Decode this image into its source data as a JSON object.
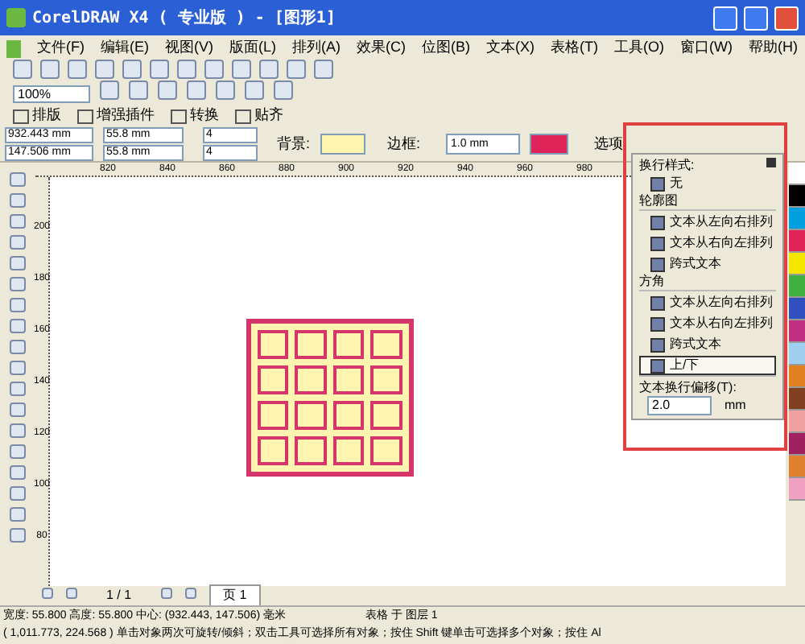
{
  "window": {
    "title": "CorelDRAW X4 ( 专业版 ) - [图形1]"
  },
  "menu": [
    "文件(F)",
    "编辑(E)",
    "视图(V)",
    "版面(L)",
    "排列(A)",
    "效果(C)",
    "位图(B)",
    "文本(X)",
    "表格(T)",
    "工具(O)",
    "窗口(W)",
    "帮助(H)"
  ],
  "zoom": {
    "value": "100%"
  },
  "plugin_toolbar": [
    "排版",
    "增强插件",
    "转换",
    "贴齐"
  ],
  "property_bar": {
    "x": "932.443 mm",
    "y": "147.506 mm",
    "width": "55.8 mm",
    "height": "55.8 mm",
    "columns": "4",
    "rows": "4",
    "background_label": "背景:",
    "border_label": "边框:",
    "border_width": "1.0 mm",
    "options": "选项"
  },
  "ruler": {
    "x_ticks": [
      "820",
      "840",
      "860",
      "880",
      "900",
      "920",
      "940",
      "960",
      "980"
    ],
    "y_ticks": [
      "200",
      "180",
      "160",
      "140",
      "120",
      "100",
      "80"
    ]
  },
  "wrap_panel": {
    "title": "换行样式:",
    "sections": [
      {
        "items": [
          {
            "label": "无",
            "selected": false
          }
        ]
      },
      {
        "heading": "轮廓图",
        "items": [
          {
            "label": "文本从左向右排列",
            "selected": false
          },
          {
            "label": "文本从右向左排列",
            "selected": false
          },
          {
            "label": "跨式文本",
            "selected": false
          }
        ]
      },
      {
        "heading": "方角",
        "items": [
          {
            "label": "文本从左向右排列",
            "selected": false
          },
          {
            "label": "文本从右向左排列",
            "selected": false
          },
          {
            "label": "跨式文本",
            "selected": false
          },
          {
            "label": "上/下",
            "selected": true
          }
        ]
      }
    ],
    "offset_label": "文本换行偏移(T):",
    "offset_value": "2.0",
    "offset_unit": "mm"
  },
  "page_nav": {
    "count": "1 / 1",
    "tab": "页 1"
  },
  "status": {
    "line1_left": "宽度: 55.800  高度: 55.800  中心: (932.443, 147.506)  毫米",
    "line1_right": "表格 于 图层 1",
    "line2": "( 1,011.773, 224.568 ) 单击对象两次可旋转/倾斜；双击工具可选择所有对象；按住 Shift 键单击可选择多个对象；按住 Al"
  }
}
